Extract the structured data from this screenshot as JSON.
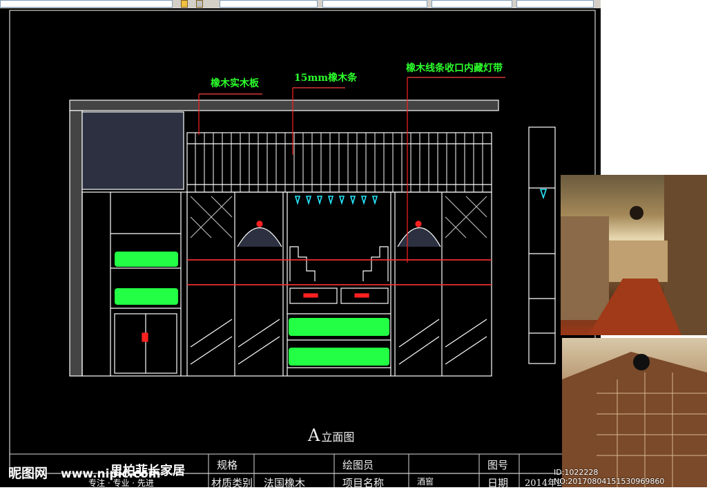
{
  "callouts": {
    "oak_board": "橡木实木板",
    "oak_strip": "15mm橡木条",
    "oak_trim_light": "橡木线条收口内藏灯带"
  },
  "view_title": {
    "letter": "A",
    "name": "立面图"
  },
  "title_block": {
    "spec": "规格",
    "drafter": "绘图员",
    "drawing_no": "图号",
    "material_category": "材质类别",
    "material_value": "法国橡木",
    "project_name": "项目名称",
    "project_value": "酒窖",
    "date": "日期",
    "date_value": "2014年2月"
  },
  "watermark": {
    "logo": "昵图网",
    "url": "www.nipic.com",
    "brand": "思柏菲长家居",
    "slogan": "专注 · 专业 · 先进",
    "id": "ID:1022228 NO:20170804151530969860"
  },
  "colors": {
    "line": "#ffffff",
    "accent": "#ff2020",
    "bottles": "#22ff44",
    "glasses": "#28e8ff",
    "callout": "#2cff2c"
  },
  "photos": [
    "wine-cellar-photo",
    "wine-cellar-photo"
  ]
}
